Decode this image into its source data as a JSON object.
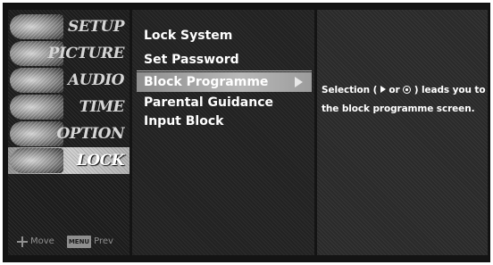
{
  "sidebar": {
    "categories": [
      {
        "label": "SETUP"
      },
      {
        "label": "PICTURE"
      },
      {
        "label": "AUDIO"
      },
      {
        "label": "TIME"
      },
      {
        "label": "OPTION"
      },
      {
        "label": "LOCK"
      }
    ],
    "active": "LOCK",
    "hint": {
      "move_label": "Move",
      "menu_key_label": "MENU",
      "prev_label": "Prev"
    }
  },
  "menu": {
    "items": [
      {
        "label": "Lock System"
      },
      {
        "label": "Set Password"
      },
      {
        "label": "Block Programme"
      },
      {
        "label": "Parental Guidance"
      },
      {
        "label": "Input Block"
      }
    ],
    "selected": "Block Programme"
  },
  "info": {
    "text_part1": "Selection (",
    "text_or": "or",
    "text_part2": ") leads you to the block programme screen."
  },
  "icons": {
    "move": "four-way-arrow-icon",
    "menu_key": "menu-key-icon",
    "right_arrow": "right-arrow-icon",
    "ok": "ok-button-icon"
  }
}
